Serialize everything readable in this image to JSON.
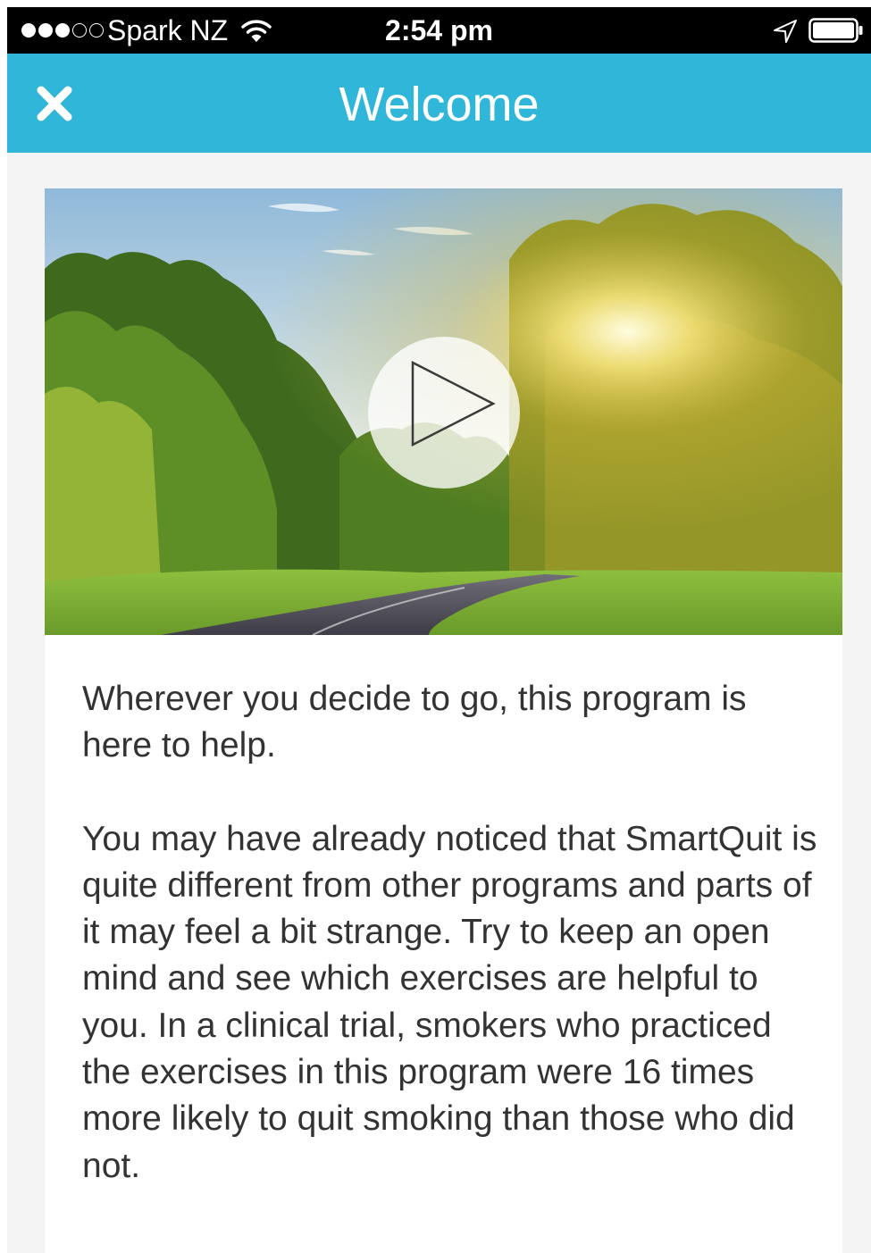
{
  "status_bar": {
    "carrier": "Spark NZ",
    "time": "2:54 pm",
    "signal_bars_filled": 3,
    "signal_bars_total": 5,
    "icons": [
      "wifi-icon",
      "location-arrow-icon",
      "battery-icon"
    ]
  },
  "nav": {
    "title": "Welcome",
    "close_icon": "close-icon",
    "background_color": "#30b6d9"
  },
  "video": {
    "play_icon": "play-icon"
  },
  "content": {
    "paragraph_1": "Wherever you decide to go, this program is here to help.",
    "paragraph_2": "You may have already noticed that SmartQuit is quite different from other programs and parts of it may feel a bit strange. Try to keep an open mind and see which exercises are helpful to you. In a clinical trial, smokers who practiced the exercises in this program were 16 times more likely to quit smoking than those who did not."
  }
}
